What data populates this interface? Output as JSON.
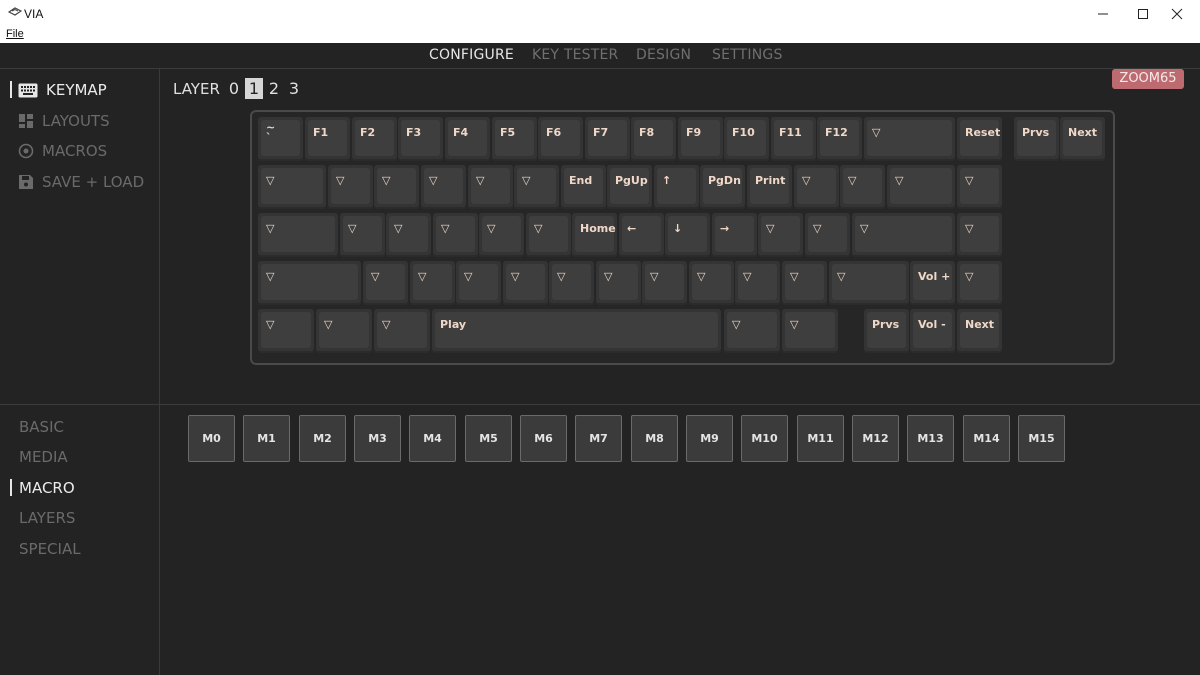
{
  "window": {
    "title": "VIA",
    "menu_file": "File"
  },
  "tabs": [
    "CONFIGURE",
    "KEY TESTER",
    "DESIGN",
    "SETTINGS"
  ],
  "active_tab": "CONFIGURE",
  "sidebar": {
    "items": [
      {
        "label": "KEYMAP",
        "icon": "keyboard-icon",
        "active": true
      },
      {
        "label": "LAYOUTS",
        "icon": "layouts-icon",
        "active": false
      },
      {
        "label": "MACROS",
        "icon": "macros-icon",
        "active": false
      },
      {
        "label": "SAVE + LOAD",
        "icon": "save-icon",
        "active": false
      }
    ]
  },
  "layer": {
    "label": "LAYER",
    "numbers": [
      "0",
      "1",
      "2",
      "3"
    ],
    "selected": "1"
  },
  "device_badge": "ZOOM65",
  "keyboard": {
    "row1": [
      "~\n`",
      "F1",
      "F2",
      "F3",
      "F4",
      "F5",
      "F6",
      "F7",
      "F8",
      "F9",
      "F10",
      "F11",
      "F12",
      "▽",
      "Reset",
      "Prvs",
      "Next"
    ],
    "row2": [
      "▽",
      "▽",
      "▽",
      "▽",
      "▽",
      "▽",
      "End",
      "PgUp",
      "↑",
      "PgDn",
      "Print",
      "▽",
      "▽",
      "▽",
      "▽"
    ],
    "row3": [
      "▽",
      "▽",
      "▽",
      "▽",
      "▽",
      "▽",
      "Home",
      "←",
      "↓",
      "→",
      "▽",
      "▽",
      "▽",
      "▽"
    ],
    "row4": [
      "▽",
      "▽",
      "▽",
      "▽",
      "▽",
      "▽",
      "▽",
      "▽",
      "▽",
      "▽",
      "▽",
      "▽",
      "Vol +",
      "▽"
    ],
    "row5": [
      "▽",
      "▽",
      "▽",
      "Play",
      "▽",
      "▽",
      "Prvs",
      "Vol -",
      "Next"
    ]
  },
  "categories": {
    "items": [
      "BASIC",
      "MEDIA",
      "MACRO",
      "LAYERS",
      "SPECIAL"
    ],
    "active": "MACRO"
  },
  "macros": [
    "M0",
    "M1",
    "M2",
    "M3",
    "M4",
    "M5",
    "M6",
    "M7",
    "M8",
    "M9",
    "M10",
    "M11",
    "M12",
    "M13",
    "M14",
    "M15"
  ],
  "colors": {
    "badge": "#bd6b70",
    "background": "#232323",
    "keycap": "#3e3e3e",
    "legend": "#f0d8c8"
  }
}
